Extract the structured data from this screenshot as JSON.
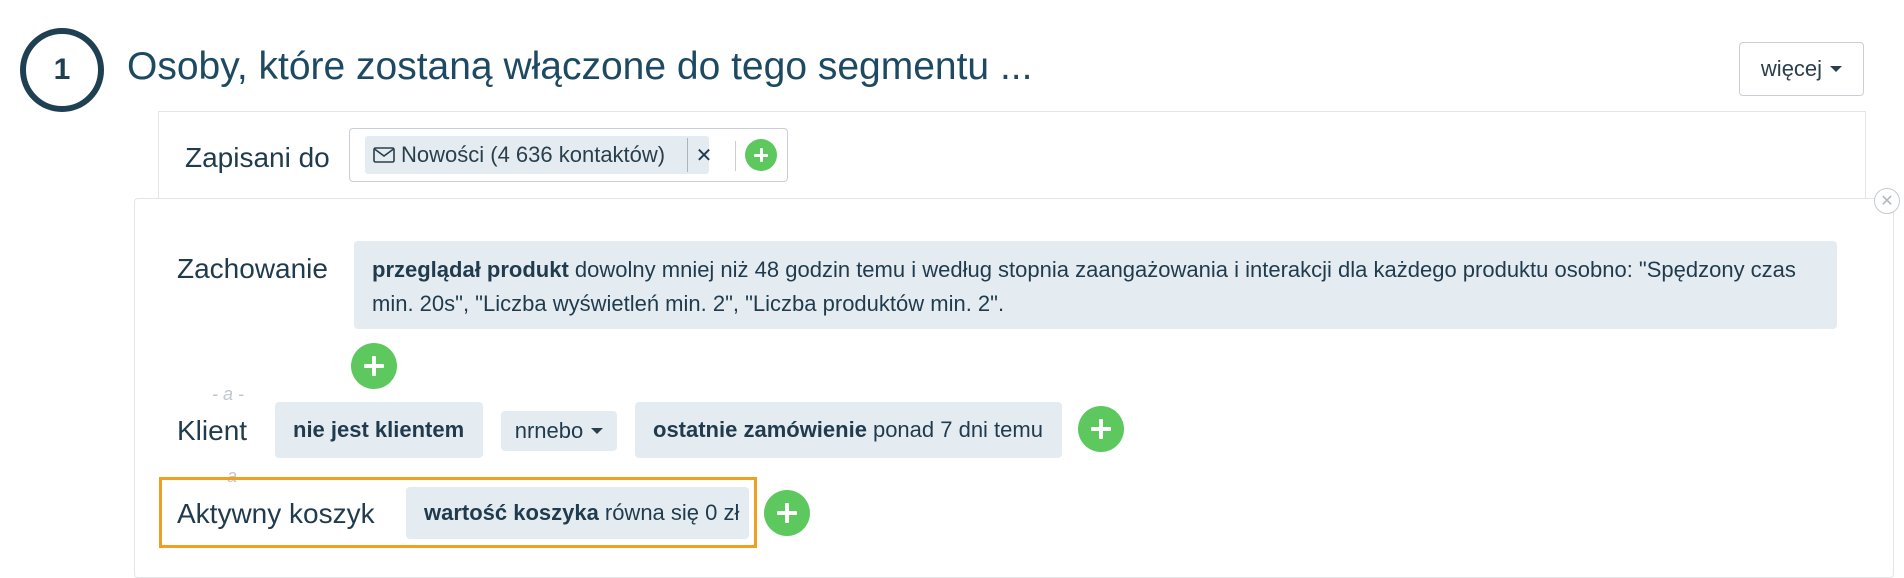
{
  "step": {
    "number": "1",
    "title": "Osoby, które zostaną włączone do tego segmentu ..."
  },
  "more_button": {
    "label": "więcej",
    "icon": "caret-down-icon"
  },
  "subscribed": {
    "label": "Zapisani do",
    "tag_text": "Nowości (4 636 kontaktów)",
    "tag_icon": "envelope-icon",
    "remove_symbol": "✕"
  },
  "behavior": {
    "label": "Zachowanie",
    "bold": "przeglądał produkt",
    "text": "dowolny mniej niż 48 godzin temu i według stopnia zaangażowania i interakcji dla każdego produktu osobno: \"Spędzony czas min. 20s\", \"Liczba wyświetleń min. 2\", \"Liczba produktów min. 2\"."
  },
  "separators": {
    "and_1": "- a -",
    "and_2": "a"
  },
  "client": {
    "label": "Klient",
    "chip1": "nie jest klientem",
    "operator": "nrnebo",
    "chip2_bold": "ostatnie zamówienie",
    "chip2_text": "ponad 7 dni temu"
  },
  "cart": {
    "label": "Aktywny koszyk",
    "chip_bold": "wartość koszyka",
    "chip_text": "równa się 0 zł"
  },
  "colors": {
    "accent_green": "#5cc85e",
    "highlight": "#f0a020",
    "chip_bg": "#e5ecf1",
    "title": "#1d4a62"
  }
}
